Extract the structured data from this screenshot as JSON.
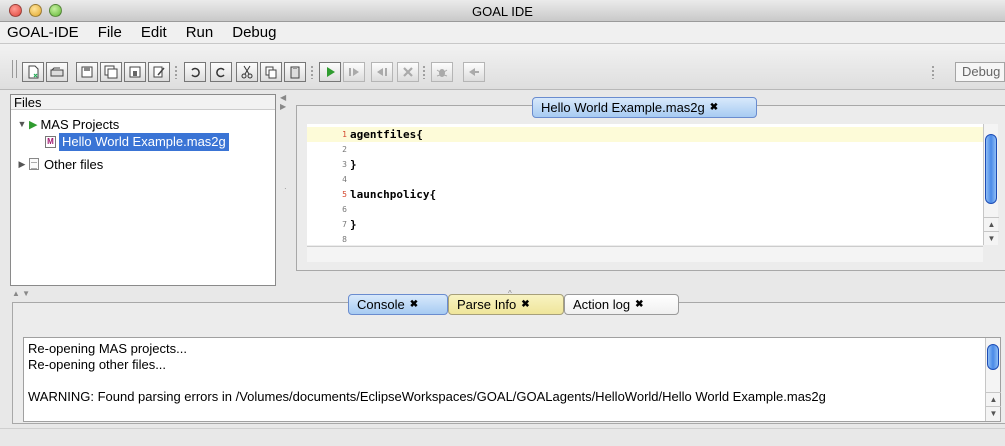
{
  "window": {
    "title": "GOAL IDE"
  },
  "menu": [
    "GOAL-IDE",
    "File",
    "Edit",
    "Run",
    "Debug"
  ],
  "toolbar": {
    "debug_label": "Debug"
  },
  "files_panel": {
    "title": "Files",
    "mas_projects": "MAS Projects",
    "project_file": "Hello World Example.mas2g",
    "other_files": "Other files"
  },
  "editor": {
    "tab_label": "Hello World Example.mas2g",
    "lines": [
      {
        "num": "1",
        "text": "agentfiles{"
      },
      {
        "num": "2",
        "text": ""
      },
      {
        "num": "3",
        "text": "}"
      },
      {
        "num": "4",
        "text": ""
      },
      {
        "num": "5",
        "text": "launchpolicy{"
      },
      {
        "num": "6",
        "text": ""
      },
      {
        "num": "7",
        "text": "}"
      },
      {
        "num": "8",
        "text": ""
      }
    ]
  },
  "bottom_tabs": {
    "console": "Console",
    "parse_info": "Parse Info",
    "action_log": "Action log"
  },
  "console": {
    "line1": "Re-opening MAS projects...",
    "line2": "Re-opening other files...",
    "line3": "WARNING: Found parsing errors in /Volumes/documents/EclipseWorkspaces/GOAL/GOALagents/HelloWorld/Hello World Example.mas2g"
  },
  "colors": {
    "accent": "#3a74d5",
    "tab_active": "#a7cbf2",
    "tab_parse": "#efe59a",
    "run_green": "#2f9c2f",
    "line_highlight": "#fdfbd8"
  }
}
